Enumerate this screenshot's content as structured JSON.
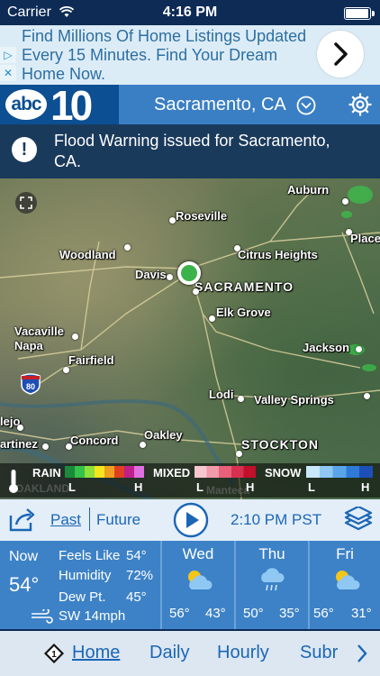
{
  "status_bar": {
    "carrier": "Carrier",
    "time": "4:16 PM",
    "battery_level": 0.95
  },
  "ad": {
    "text": "Find Millions Of Home Listings Updated Every 15 Minutes. Find Your Dream Home Now.",
    "adchoices_icon": "play-triangle-icon",
    "close_icon": "x-icon",
    "go_icon": "chevron-right-icon"
  },
  "header": {
    "logo_abc": "abc",
    "logo_number": "10",
    "location": "Sacramento, CA",
    "location_icon": "chevron-down-circle-icon",
    "settings_icon": "gear-icon"
  },
  "alert": {
    "icon": "exclamation-icon",
    "text": "Flood Warning issued for Sacramento, CA."
  },
  "map": {
    "cities": [
      {
        "name": "Auburn",
        "key": "auburn"
      },
      {
        "name": "Roseville",
        "key": "roseville"
      },
      {
        "name": "Woodland",
        "key": "woodland"
      },
      {
        "name": "Citrus Heights",
        "key": "citrus-heights"
      },
      {
        "name": "Place",
        "key": "placerville"
      },
      {
        "name": "Davis",
        "key": "davis"
      },
      {
        "name": "SACRAMENTO",
        "key": "sacramento"
      },
      {
        "name": "Elk Grove",
        "key": "elk-grove"
      },
      {
        "name": "Vacaville",
        "key": "vacaville"
      },
      {
        "name": "Napa",
        "key": "napa"
      },
      {
        "name": "Jackson",
        "key": "jackson"
      },
      {
        "name": "Fairfield",
        "key": "fairfield"
      },
      {
        "name": "Lodi",
        "key": "lodi"
      },
      {
        "name": "Valley Springs",
        "key": "valley-springs"
      },
      {
        "name": "lejo",
        "key": "vallejo"
      },
      {
        "name": "Oakley",
        "key": "oakley"
      },
      {
        "name": "Concord",
        "key": "concord"
      },
      {
        "name": "artinez",
        "key": "martinez"
      },
      {
        "name": "STOCKTON",
        "key": "stockton"
      },
      {
        "name": "OAKLAND",
        "key": "oakland"
      },
      {
        "name": "Manteca",
        "key": "manteca"
      }
    ],
    "highway_shield": "80",
    "legend": {
      "rain": "RAIN",
      "mixed": "MIXED",
      "snow": "SNOW",
      "low": "L",
      "high": "H",
      "rain_colors": [
        "#1a8a3a",
        "#35c24a",
        "#8fe03a",
        "#f5e61d",
        "#f0a020",
        "#e04020",
        "#c0208a",
        "#e070e0"
      ],
      "mixed_colors": [
        "#f7c7d0",
        "#f09aaa",
        "#e8607a",
        "#d83050",
        "#c0102a"
      ],
      "snow_colors": [
        "#c9e8fb",
        "#8fc8f3",
        "#5aa4ea",
        "#2f7ad6",
        "#1c4fb8"
      ]
    }
  },
  "playbar": {
    "share_icon": "share-icon",
    "past": "Past",
    "future": "Future",
    "play_icon": "play-icon",
    "time": "2:10 PM PST",
    "layers_icon": "layers-icon"
  },
  "current": {
    "now": "Now",
    "temp": "54°",
    "feels_like_label": "Feels Like",
    "feels_like": "54°",
    "humidity_label": "Humidity",
    "humidity": "72%",
    "dew_label": "Dew Pt.",
    "dew": "45°",
    "wind_icon": "wind-icon",
    "wind": "SW 14mph"
  },
  "forecast": [
    {
      "day": "Wed",
      "icon": "partly-cloudy-icon",
      "hi": "56°",
      "lo": "43°"
    },
    {
      "day": "Thu",
      "icon": "rain-cloud-icon",
      "hi": "50°",
      "lo": "35°"
    },
    {
      "day": "Fri",
      "icon": "partly-cloudy-icon",
      "hi": "56°",
      "lo": "31°"
    }
  ],
  "nav": {
    "badge": "1",
    "items": [
      "Home",
      "Daily",
      "Hourly",
      "Subr"
    ],
    "next_icon": "chevron-right-icon"
  },
  "colors": {
    "brand_dark": "#0c4f92",
    "header_blue": "#3a7fc4",
    "panel_blue": "#3d82c7",
    "link_blue": "#1b66b6",
    "location_dot": "#3cb34a"
  }
}
